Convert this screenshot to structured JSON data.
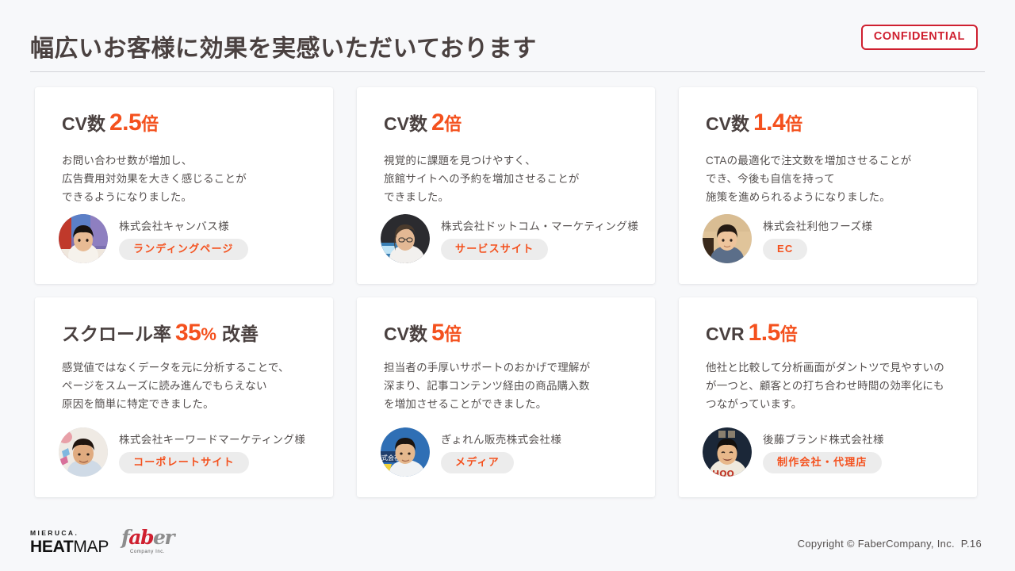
{
  "header": {
    "title": "幅広いお客様に効果を実感いただいております",
    "confidential_label": "CONFIDENTIAL"
  },
  "colors": {
    "accent": "#F4511E",
    "confidential": "#CF2030",
    "text_dark": "#4A4140",
    "text_body": "#55504F",
    "page_bg": "#F7F8FA",
    "card_bg": "#FFFFFF",
    "pill_bg": "#ECECEC"
  },
  "cards": [
    {
      "metric_label": "CV数",
      "metric_value": "2.5",
      "metric_unit": "倍",
      "metric_suffix": "",
      "body": "お問い合わせ数が増加し、\n広告費用対効果を大きく感じることが\nできるようになりました。",
      "company": "株式会社キャンバス様",
      "category": "ランディングページ"
    },
    {
      "metric_label": "CV数",
      "metric_value": "2",
      "metric_unit": "倍",
      "metric_suffix": "",
      "body": "視覚的に課題を見つけやすく、\n旅館サイトへの予約を増加させることが\nできました。",
      "company": "株式会社ドットコム・マーケティング様",
      "category": "サービスサイト"
    },
    {
      "metric_label": "CV数",
      "metric_value": "1.4",
      "metric_unit": "倍",
      "metric_suffix": "",
      "body": "CTAの最適化で注文数を増加させることが\nでき、今後も自信を持って\n施策を進められるようになりました。",
      "company": "株式会社利他フーズ様",
      "category": "EC"
    },
    {
      "metric_label": "スクロール率",
      "metric_value": "35",
      "metric_unit": "%",
      "metric_suffix": "改善",
      "body": "感覚値ではなくデータを元に分析することで、\nページをスムーズに読み進んでもらえない\n原因を簡単に特定できました。",
      "company": "株式会社キーワードマーケティング様",
      "category": "コーポレートサイト"
    },
    {
      "metric_label": "CV数",
      "metric_value": "5",
      "metric_unit": "倍",
      "metric_suffix": "",
      "body": "担当者の手厚いサポートのおかげで理解が\n深まり、記事コンテンツ経由の商品購入数\nを増加させることができました。",
      "company": "ぎょれん販売株式会社様",
      "category": "メディア"
    },
    {
      "metric_label": "CVR",
      "metric_value": "1.5",
      "metric_unit": "倍",
      "metric_suffix": "",
      "body": "他社と比較して分析画面がダントツで見やすいの\nが一つと、顧客との打ち合わせ時間の効率化にも\nつながっています。",
      "company": "後藤ブランド株式会社様",
      "category": "制作会社・代理店"
    }
  ],
  "footer": {
    "mieruca_top": "MIERUCA.",
    "mieruca_heat": "HEAT",
    "mieruca_map": "MAP",
    "faber_mark_a": "f",
    "faber_mark_b": "ab",
    "faber_mark_c": "er",
    "faber_sub": "Company Inc.",
    "copyright": "Copyright © FaberCompany, Inc.  P.16"
  }
}
